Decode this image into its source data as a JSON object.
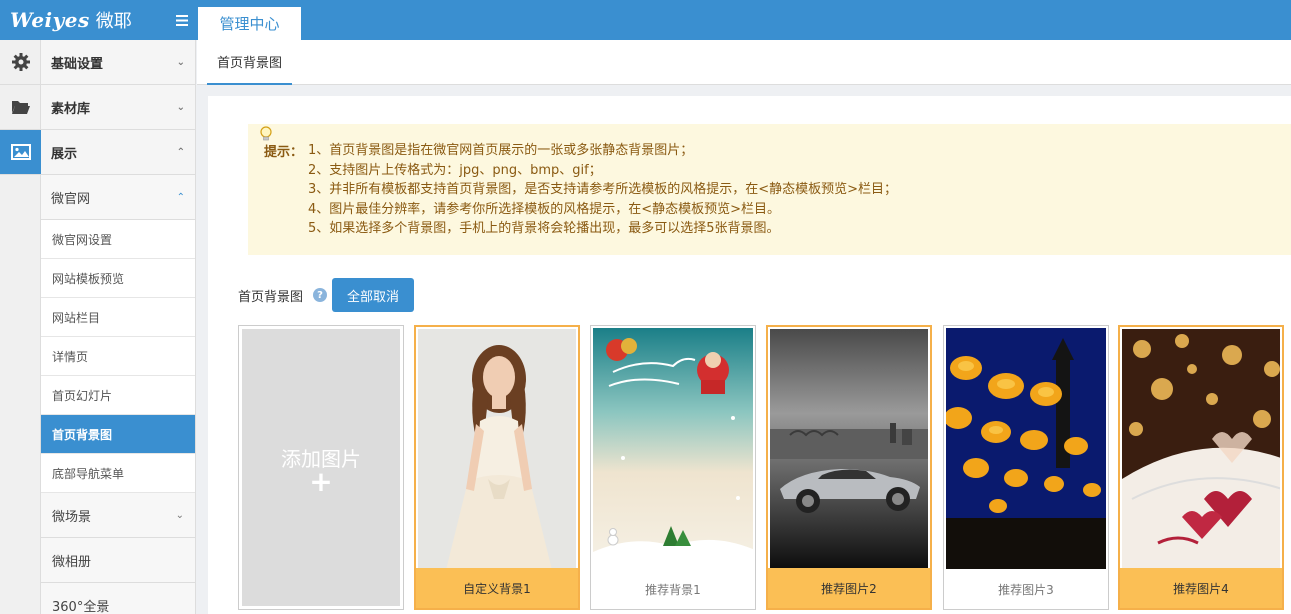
{
  "header": {
    "brand": "Weiyes",
    "brand_cn": "微耶",
    "active_tab": "管理中心"
  },
  "sidebar": {
    "groups": [
      {
        "label": "基础设置",
        "icon": "gear-icon"
      },
      {
        "label": "素材库",
        "icon": "folder-icon"
      },
      {
        "label": "展示",
        "icon": "image-icon"
      }
    ],
    "sub_group": "微官网",
    "items": [
      "微官网设置",
      "网站模板预览",
      "网站栏目",
      "详情页",
      "首页幻灯片",
      "首页背景图",
      "底部导航菜单"
    ],
    "active_item": "首页背景图",
    "more": [
      "微场景",
      "微相册",
      "360°全景"
    ]
  },
  "subnav": {
    "tab": "首页背景图"
  },
  "tips": {
    "label": "提示：",
    "lines": [
      "1、首页背景图是指在微官网首页展示的一张或多张静态背景图片；",
      "2、支持图片上传格式为：jpg、png、bmp、gif；",
      "3、并非所有模板都支持首页背景图，是否支持请参考所选模板的风格提示，在<静态模板预览>栏目；",
      "4、图片最佳分辨率，请参考你所选择模板的风格提示，在<静态模板预览>栏目。",
      "5、如果选择多个背景图，手机上的背景将会轮播出现，最多可以选择5张背景图。"
    ]
  },
  "background": {
    "label": "首页背景图",
    "help": "?",
    "cancel_all": "全部取消",
    "add_label": "添加图片",
    "add_plus": "+",
    "cards": [
      {
        "caption": "自定义背景1",
        "selected": true,
        "art": "portrait"
      },
      {
        "caption": "推荐背景1",
        "selected": false,
        "art": "christmas"
      },
      {
        "caption": "推荐图片2",
        "selected": true,
        "art": "car"
      },
      {
        "caption": "推荐图片3",
        "selected": false,
        "art": "lanterns"
      },
      {
        "caption": "推荐图片4",
        "selected": true,
        "art": "dessert"
      }
    ]
  },
  "colors": {
    "accent": "#3a8fd0",
    "selected": "#fbbf55",
    "tip_bg": "#fdf8df",
    "tip_text": "#8a5a12"
  }
}
